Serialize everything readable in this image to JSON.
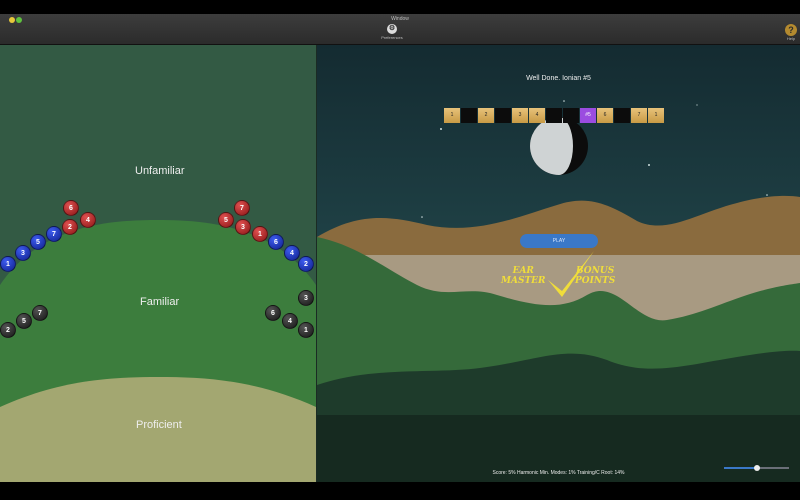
{
  "window": {
    "title": "Window",
    "preferences_label": "Preferences",
    "help_label": "Help",
    "help_glyph": "?"
  },
  "zones": {
    "unfamiliar": "Unfamiliar",
    "familiar": "Familiar",
    "proficient": "Proficient"
  },
  "balls_left": {
    "red": [
      "6",
      "2",
      "4"
    ],
    "blue": [
      "1",
      "3",
      "5",
      "7"
    ],
    "black": [
      "2",
      "5",
      "7"
    ]
  },
  "balls_right": {
    "red": [
      "5",
      "7",
      "3",
      "1"
    ],
    "blue": [
      "6",
      "4",
      "2"
    ],
    "black": [
      "3",
      "6",
      "4",
      "1"
    ]
  },
  "game": {
    "status": "Well Done. Ionian #5",
    "keys": [
      "1",
      "",
      "2",
      "",
      "3",
      "4",
      "",
      "",
      "#5",
      "6",
      "",
      "7",
      "1"
    ],
    "play_label": "PLAY",
    "badge_left": [
      "EAR",
      "MASTER"
    ],
    "badge_right": [
      "BONUS",
      "POINTS"
    ],
    "score": "Score: 5%  Harmonic Min. Modes: 1%  Training/C Root: 14%",
    "volume": 0.5
  },
  "colors": {
    "hill": "#3c7d3d",
    "proficient": "#a3a771",
    "badge": "#f0dd3a",
    "play": "#3a78c8",
    "key_highlight": "#9b4ce0"
  }
}
